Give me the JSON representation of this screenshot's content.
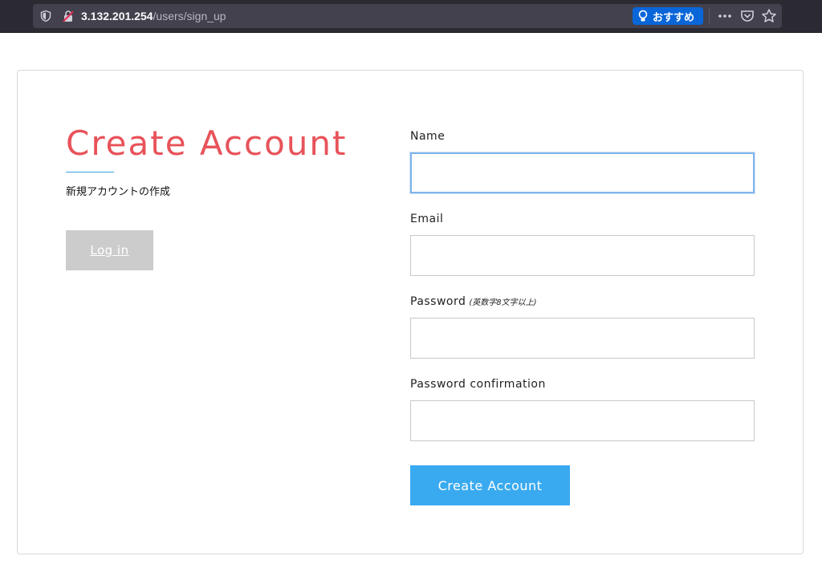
{
  "browser": {
    "url_host": "3.132.201.254",
    "url_path": "/users/sign_up",
    "recommend_label": "おすすめ"
  },
  "page": {
    "title": "Create Account",
    "subtitle": "新規アカウントの作成",
    "login_label": "Log in"
  },
  "form": {
    "name_label": "Name",
    "name_value": "",
    "email_label": "Email",
    "email_value": "",
    "password_label": "Password",
    "password_hint": "(英数字8文字以上)",
    "password_value": "",
    "password_confirmation_label": "Password confirmation",
    "password_confirmation_value": "",
    "submit_label": "Create Account"
  },
  "colors": {
    "title": "#e8535a",
    "accent_line": "#3aa0e8",
    "submit": "#3aaaf0",
    "login": "#cccccc"
  }
}
